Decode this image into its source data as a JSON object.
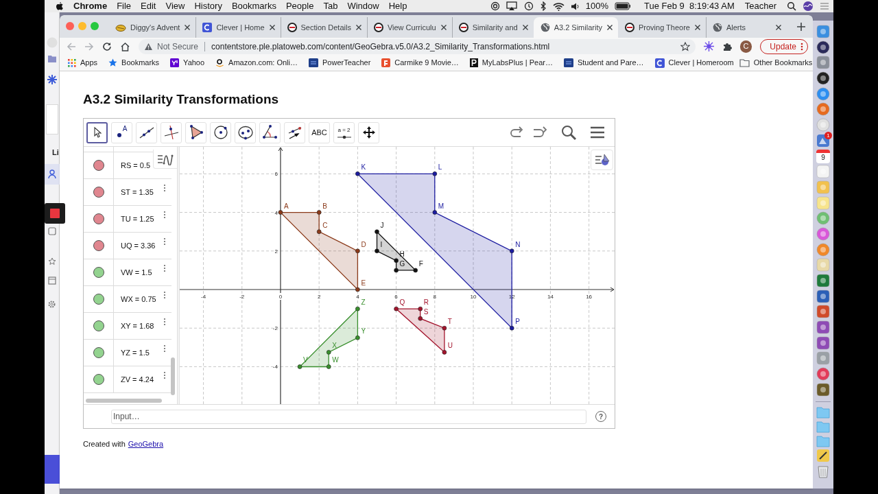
{
  "menubar": {
    "app": "Chrome",
    "menus": [
      "File",
      "Edit",
      "View",
      "History",
      "Bookmarks",
      "People",
      "Tab",
      "Window",
      "Help"
    ],
    "battery": "100%",
    "clock": "Tue Feb 9  8:19:43 AM",
    "user": "Teacher"
  },
  "background_window": {
    "fragment": "Li"
  },
  "browser": {
    "tabs": [
      {
        "title": "Diggy's Advent",
        "kind": "diggy",
        "selected": false
      },
      {
        "title": "Clever | Home",
        "kind": "clever",
        "selected": false
      },
      {
        "title": "Section Details",
        "kind": "edmentum",
        "selected": false
      },
      {
        "title": "View Curriculu",
        "kind": "edmentum",
        "selected": false
      },
      {
        "title": "Similarity and",
        "kind": "edmentum",
        "selected": false
      },
      {
        "title": "A3.2 Similarity",
        "kind": "globe",
        "selected": true
      },
      {
        "title": "Proving Theore",
        "kind": "edmentum",
        "selected": false
      },
      {
        "title": "Alerts",
        "kind": "globe",
        "selected": false
      }
    ],
    "address": {
      "security": "Not Secure",
      "url": "contentstore.ple.platoweb.com/content/GeoGebra.v5.0/A3.2_Similarity_Transformations.html"
    },
    "avatar": "C",
    "update_button": "Update",
    "bookmarks": [
      {
        "label": "Apps",
        "kind": "apps"
      },
      {
        "label": "Bookmarks",
        "kind": "star"
      },
      {
        "label": "Yahoo",
        "kind": "yahoo"
      },
      {
        "label": "Amazon.com: Onli…",
        "kind": "amazon"
      },
      {
        "label": "PowerTeacher",
        "kind": "sis"
      },
      {
        "label": "Carmike 9 Movie…",
        "kind": "carmike"
      },
      {
        "label": "MyLabsPlus | Pear…",
        "kind": "mylabs"
      },
      {
        "label": "Student and Pare…",
        "kind": "sis"
      },
      {
        "label": "Clever | Homeroom",
        "kind": "clever"
      }
    ],
    "other_bookmarks": "Other Bookmarks"
  },
  "page": {
    "title": "A3.2 Similarity Transformations",
    "applet": {
      "tools": [
        {
          "kind": "move",
          "selected": true
        },
        {
          "kind": "point",
          "label": "A",
          "selected": false
        },
        {
          "kind": "line",
          "selected": false
        },
        {
          "kind": "perpendicular",
          "selected": false
        },
        {
          "kind": "polygon",
          "selected": false
        },
        {
          "kind": "circle",
          "selected": false
        },
        {
          "kind": "conic",
          "selected": false
        },
        {
          "kind": "angle",
          "selected": false
        },
        {
          "kind": "reflect",
          "selected": false
        },
        {
          "kind": "text",
          "label": "ABC",
          "selected": false
        },
        {
          "kind": "slider",
          "label": "a = 2",
          "selected": false
        },
        {
          "kind": "move_view",
          "selected": false
        }
      ],
      "algebra": [
        {
          "text": "RS = 0.5",
          "color": "#e0868f",
          "menu": false
        },
        {
          "text": "ST = 1.35",
          "color": "#e0868f",
          "menu": true
        },
        {
          "text": "TU = 1.25",
          "color": "#e0868f",
          "menu": true
        },
        {
          "text": "UQ = 3.36",
          "color": "#e0868f",
          "menu": true
        },
        {
          "text": "VW = 1.5",
          "color": "#93d38f",
          "menu": true
        },
        {
          "text": "WX = 0.75",
          "color": "#93d38f",
          "menu": true
        },
        {
          "text": "XY = 1.68",
          "color": "#93d38f",
          "menu": true
        },
        {
          "text": "YZ = 1.5",
          "color": "#93d38f",
          "menu": true
        },
        {
          "text": "ZV = 4.24",
          "color": "#93d38f",
          "menu": true
        }
      ],
      "graph": {
        "chart_data": {
          "type": "area",
          "xlim": [
            -5.23,
            17.33
          ],
          "ylim": [
            -5.94,
            7.4
          ],
          "grid": true,
          "xticks": [
            -4,
            -2,
            0,
            2,
            4,
            6,
            8,
            10,
            12,
            14,
            16
          ],
          "yticks": [
            -4,
            -2,
            2,
            4,
            6
          ],
          "series": [
            {
              "color": "#8b3a1a",
              "x": [
                0,
                2,
                2,
                4,
                4
              ],
              "values": [
                4,
                4,
                3,
                2,
                0
              ]
            },
            {
              "color": "#111111",
              "x": [
                7,
                6,
                6,
                5,
                5
              ],
              "values": [
                1,
                1,
                1.5,
                2,
                3
              ]
            },
            {
              "color": "#1c1ca0",
              "x": [
                4,
                8,
                8,
                12,
                12
              ],
              "values": [
                6,
                6,
                4,
                2,
                -2
              ]
            },
            {
              "color": "#a3142c",
              "x": [
                6,
                7.25,
                7.25,
                8.5,
                8.5
              ],
              "values": [
                -1,
                -1,
                -1.5,
                -2,
                -3.25
              ]
            },
            {
              "color": "#3a8f2e",
              "x": [
                1,
                2.5,
                2.5,
                4,
                4
              ],
              "values": [
                -4,
                -4,
                -3.25,
                -2.5,
                -1
              ]
            }
          ],
          "annotations": [
            {
              "x": 0,
              "y": 4,
              "text": "A"
            },
            {
              "x": 2,
              "y": 4,
              "text": "B"
            },
            {
              "x": 2,
              "y": 3,
              "text": "C"
            },
            {
              "x": 4,
              "y": 2,
              "text": "D"
            },
            {
              "x": 4,
              "y": 0,
              "text": "E"
            },
            {
              "x": 7,
              "y": 1,
              "text": "F"
            },
            {
              "x": 6,
              "y": 1,
              "text": "G"
            },
            {
              "x": 6,
              "y": 1.5,
              "text": "H"
            },
            {
              "x": 5,
              "y": 2,
              "text": "I"
            },
            {
              "x": 5,
              "y": 3,
              "text": "J"
            },
            {
              "x": 4,
              "y": 6,
              "text": "K"
            },
            {
              "x": 8,
              "y": 6,
              "text": "L"
            },
            {
              "x": 8,
              "y": 4,
              "text": "M"
            },
            {
              "x": 12,
              "y": 2,
              "text": "N"
            },
            {
              "x": 12,
              "y": -2,
              "text": "P"
            },
            {
              "x": 6,
              "y": -1,
              "text": "Q"
            },
            {
              "x": 7.25,
              "y": -1,
              "text": "R"
            },
            {
              "x": 7.25,
              "y": -1.5,
              "text": "S"
            },
            {
              "x": 8.5,
              "y": -2,
              "text": "T"
            },
            {
              "x": 8.5,
              "y": -3.25,
              "text": "U"
            },
            {
              "x": 1,
              "y": -4,
              "text": "V"
            },
            {
              "x": 2.5,
              "y": -4,
              "text": "W"
            },
            {
              "x": 2.5,
              "y": -3.25,
              "text": "X"
            },
            {
              "x": 4,
              "y": -2.5,
              "text": "Y"
            },
            {
              "x": 4,
              "y": -1,
              "text": "Z"
            }
          ]
        }
      },
      "input": {
        "placeholder": "Input…"
      },
      "help": "?"
    },
    "footer": {
      "text": "Created with",
      "link": "GeoGebra"
    }
  },
  "dock": {
    "badge": "1",
    "calendar_day": "9"
  }
}
